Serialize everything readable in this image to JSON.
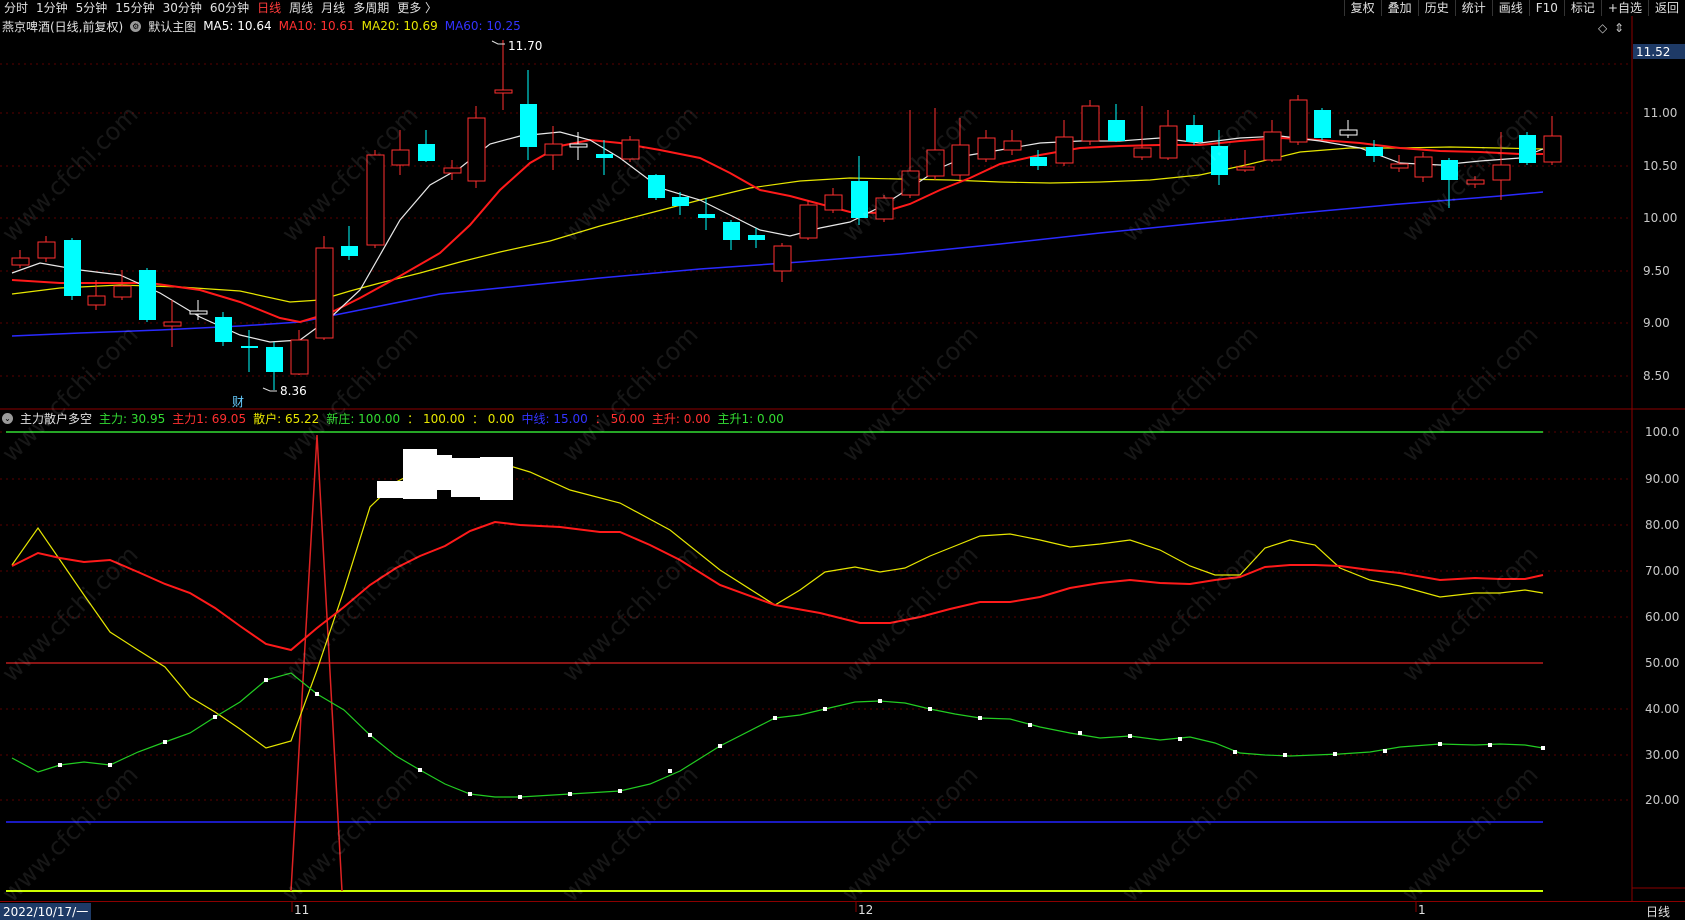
{
  "toolbar": {
    "timeframes": [
      "分时",
      "1分钟",
      "5分钟",
      "15分钟",
      "30分钟",
      "60分钟",
      "日线",
      "周线",
      "月线",
      "多周期",
      "更多 〉"
    ],
    "active": "日线",
    "right_buttons": [
      "复权",
      "叠加",
      "历史",
      "统计",
      "画线",
      "F10",
      "标记",
      "+自选",
      "返回"
    ]
  },
  "main_chart": {
    "stock_title": "燕京啤酒(日线,前复权)",
    "chart_name": "默认主图",
    "ma": [
      {
        "label": "MA5: 10.64",
        "color": "#ffffff"
      },
      {
        "label": "MA10: 10.61",
        "color": "#ff3030"
      },
      {
        "label": "MA20: 10.69",
        "color": "#e6e600"
      },
      {
        "label": "MA60: 10.25",
        "color": "#3333ff"
      }
    ],
    "current_price": "11.52",
    "high_marker": "11.70",
    "low_marker": "8.36",
    "event_badge": "财",
    "y_ticks": [
      "11.00",
      "10.50",
      "10.00",
      "9.50",
      "9.00",
      "8.50"
    ]
  },
  "indicator": {
    "name": "主力散户多空",
    "values": [
      {
        "label": "主力: 30.95",
        "color": "#33dd33"
      },
      {
        "label": "主力1: 69.05",
        "color": "#ff3030"
      },
      {
        "label": "散户: 65.22",
        "color": "#e6e600"
      },
      {
        "label": "新庄: 100.00",
        "color": "#33dd33"
      },
      {
        "label": "： 100.00",
        "color": "#e6e600"
      },
      {
        "label": "： 0.00",
        "color": "#e6e600"
      },
      {
        "label": "中线: 15.00",
        "color": "#3333ff"
      },
      {
        "label": "： 50.00",
        "color": "#ff3030"
      },
      {
        "label": "主升: 0.00",
        "color": "#ff3030"
      },
      {
        "label": "主升1: 0.00",
        "color": "#33dd33"
      }
    ],
    "y_ticks": [
      "100.0",
      "90.00",
      "80.00",
      "70.00",
      "60.00",
      "50.00",
      "40.00",
      "30.00",
      "20.00"
    ]
  },
  "x_axis": {
    "labels": [
      "2022/10/17/一",
      "11",
      "12",
      "1"
    ],
    "period": "日线"
  },
  "watermark": "www.cfchi.com",
  "colors": {
    "up": "#ff3030",
    "down": "#00ffff",
    "ma60": "#3333ff"
  }
}
